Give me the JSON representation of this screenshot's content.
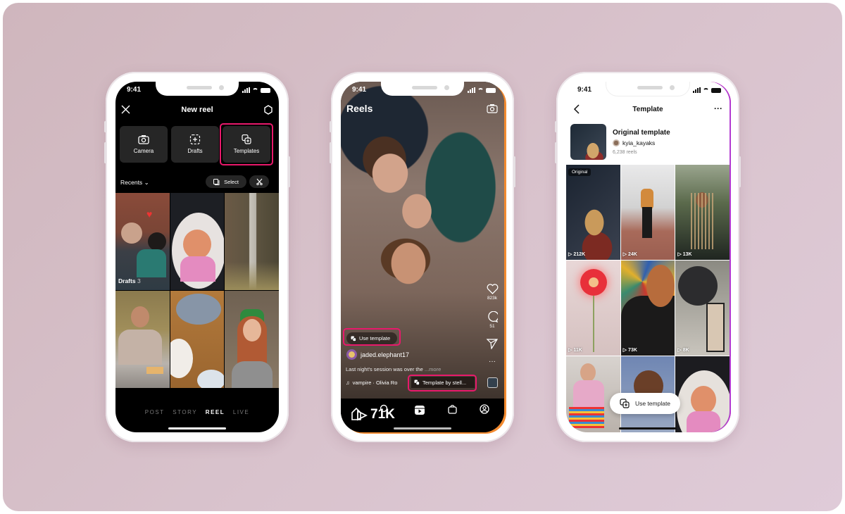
{
  "phones": {
    "new_reel": {
      "status_time": "9:41",
      "title": "New reel",
      "tiles": [
        {
          "label": "Camera",
          "icon": "camera-icon"
        },
        {
          "label": "Drafts",
          "icon": "drafts-icon"
        },
        {
          "label": "Templates",
          "icon": "templates-icon"
        }
      ],
      "recents_label": "Recents",
      "select_label": "Select",
      "drafts_label": "Drafts",
      "drafts_count": "3",
      "modes": [
        "POST",
        "STORY",
        "REEL",
        "LIVE"
      ],
      "active_mode": "REEL"
    },
    "reels": {
      "status_time": "9:41",
      "title": "Reels",
      "likes": "823k",
      "comments": "51",
      "use_template_label": "Use template",
      "username": "jaded.elephant17",
      "caption": "Last night's session was over the",
      "more_label": "...more",
      "audio": "vampire · Olivia Ro",
      "template_by": "Template by stell...",
      "nav_overlay_text": "71K"
    },
    "template": {
      "status_time": "9:41",
      "title": "Template",
      "template_name": "Original template",
      "author": "kyia_kayaks",
      "reels_count": "6,238 reels",
      "original_badge": "Original",
      "view_counts": [
        "212K",
        "24K",
        "13K",
        "11K",
        "73K",
        "8K"
      ],
      "use_template_label": "Use template"
    }
  },
  "colors": {
    "highlight": "#e8196b",
    "background": "#d4bec6"
  }
}
